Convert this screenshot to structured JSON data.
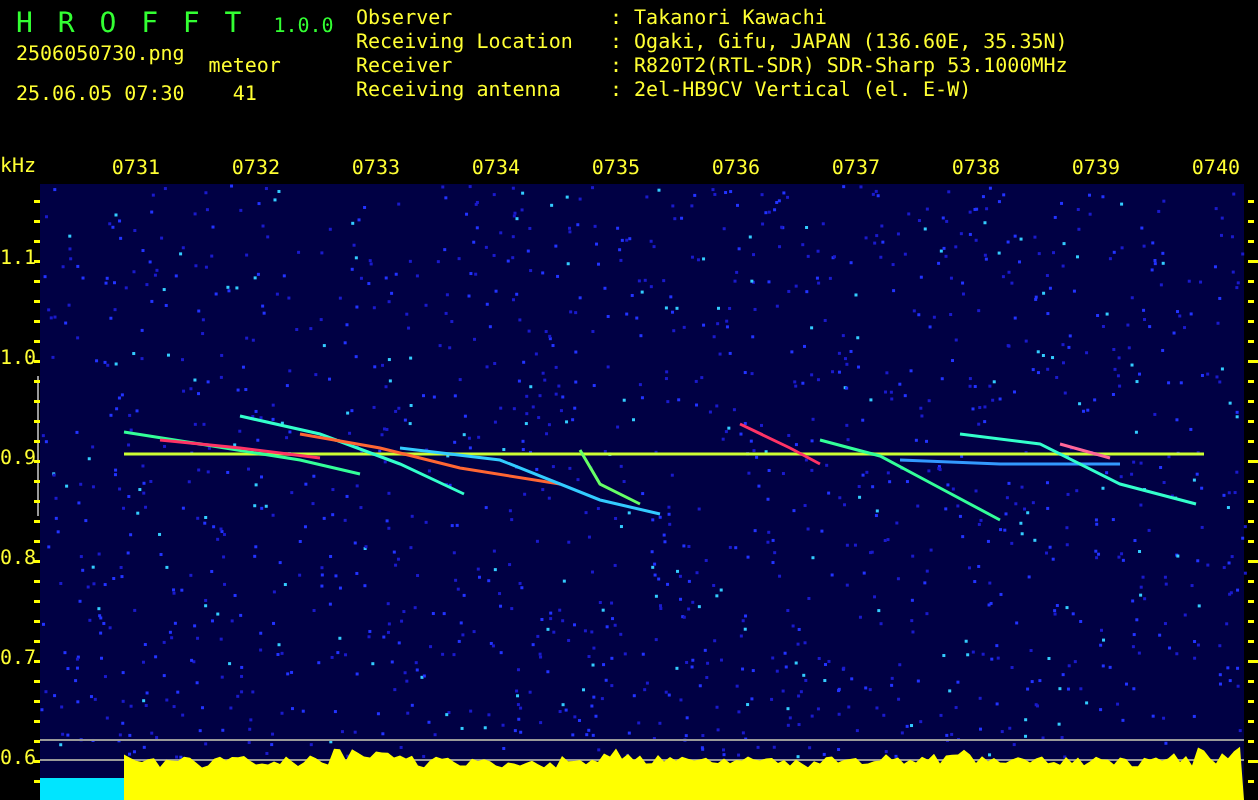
{
  "header": {
    "app_name": "H R O F F T",
    "version": "1.0.0",
    "filename": "2506050730.png",
    "timestamp": "25.06.05 07:30",
    "meteor_label": "meteor",
    "meteor_count": "41"
  },
  "station_info": [
    {
      "label": "Observer",
      "value": ": Takanori Kawachi"
    },
    {
      "label": "Receiving Location",
      "value": ": Ogaki, Gifu, JAPAN (136.60E, 35.35N)"
    },
    {
      "label": "Receiver",
      "value": ": R820T2(RTL-SDR) SDR-Sharp 53.1000MHz"
    },
    {
      "label": "Receiving antenna",
      "value": ": 2el-HB9CV Vertical (el. E-W)"
    }
  ],
  "spectrogram": {
    "unit": "kHz",
    "time_labels": [
      "0731",
      "0732",
      "0733",
      "0734",
      "0735",
      "0736",
      "0737",
      "0738",
      "0739",
      "0740"
    ],
    "freq_labels": [
      "1.1",
      "1.0",
      "0.9",
      "0.8",
      "0.7",
      "0.6"
    ]
  }
}
